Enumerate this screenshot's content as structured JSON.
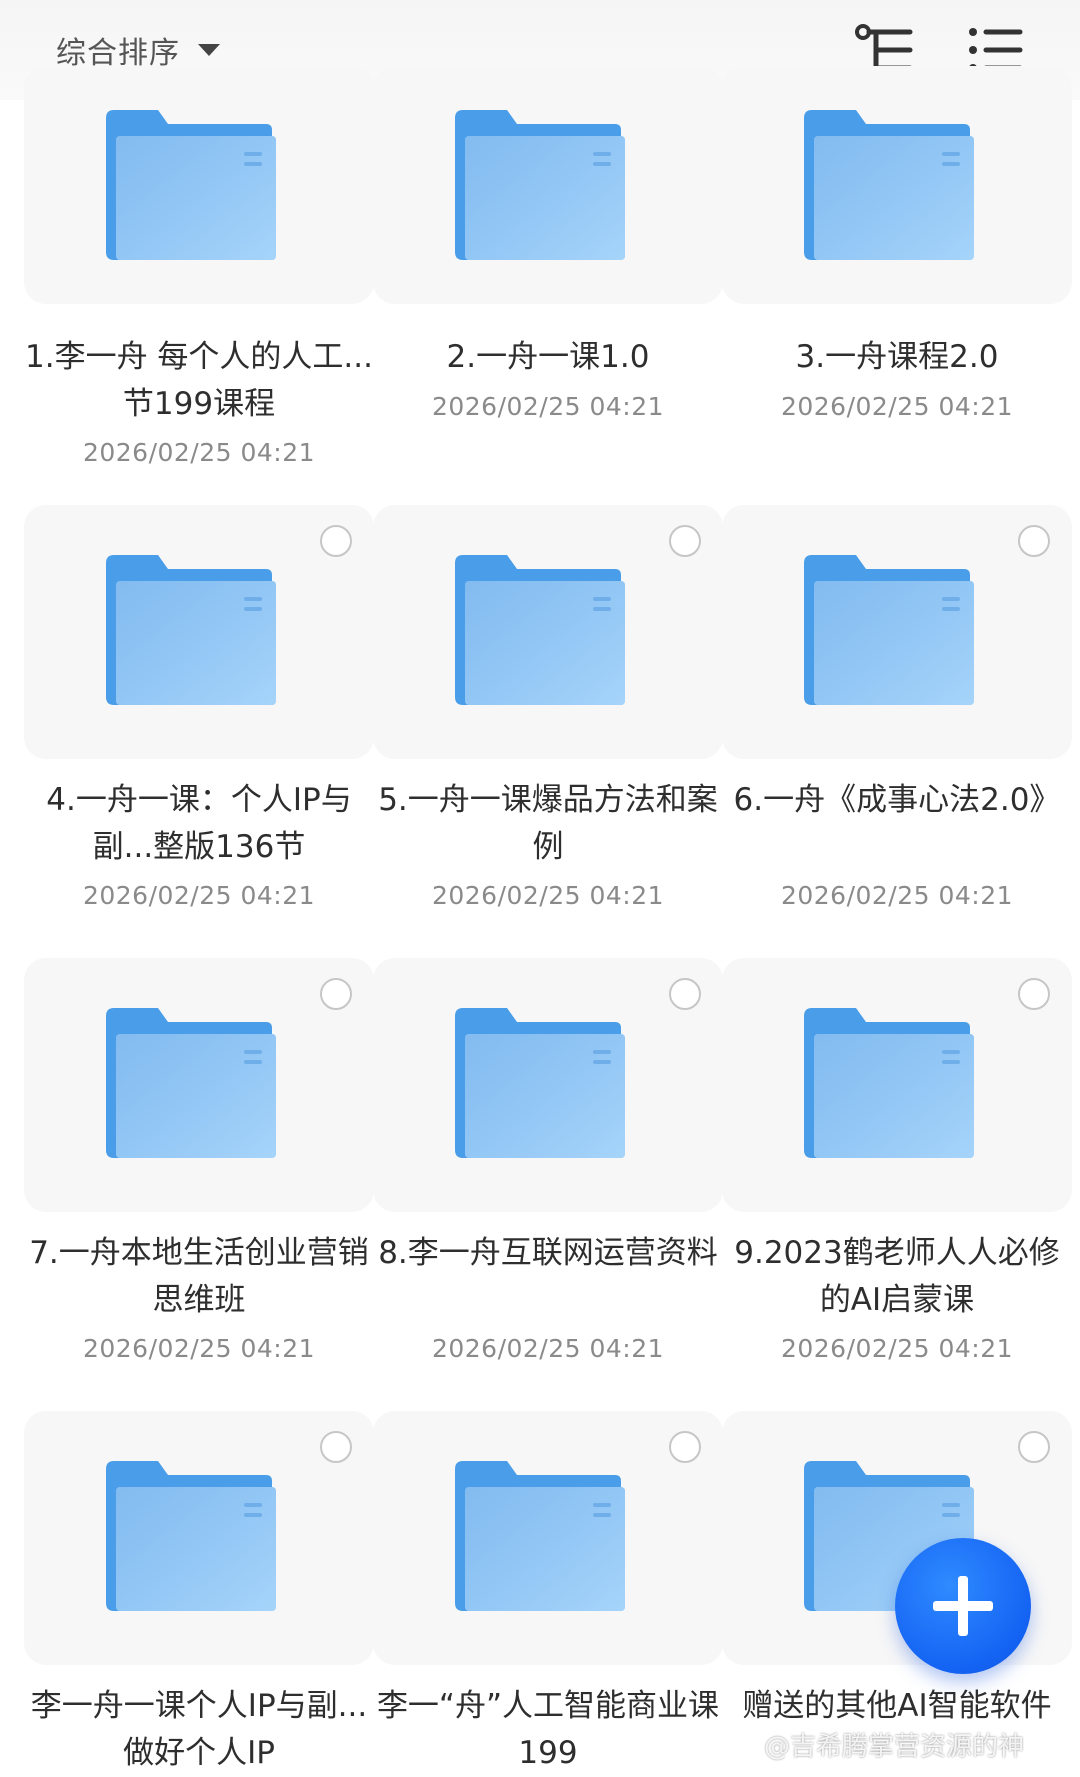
{
  "header": {
    "sort_label": "综合排序",
    "icons": [
      "hierarchy-icon",
      "list-view-icon"
    ]
  },
  "folders": [
    {
      "name": "1.李一舟 每个人的人工...节199课程",
      "date": "2026/02/25 04:21",
      "selectable": false
    },
    {
      "name": "2.一舟一课1.0",
      "date": "2026/02/25 04:21",
      "selectable": false
    },
    {
      "name": "3.一舟课程2.0",
      "date": "2026/02/25 04:21",
      "selectable": false
    },
    {
      "name": "4.一舟一课：个人IP与副...整版136节",
      "date": "2026/02/25 04:21",
      "selectable": true
    },
    {
      "name": "5.一舟一课爆品方法和案例",
      "date": "2026/02/25 04:21",
      "selectable": true
    },
    {
      "name": "6.一舟《成事心法2.0》",
      "date": "2026/02/25 04:21",
      "selectable": true
    },
    {
      "name": "7.一舟本地生活创业营销思维班",
      "date": "2026/02/25 04:21",
      "selectable": true
    },
    {
      "name": "8.李一舟互联网运营资料",
      "date": "2026/02/25 04:21",
      "selectable": true
    },
    {
      "name": "9.2023鹤老师人人必修的AI启蒙课",
      "date": "2026/02/25 04:21",
      "selectable": true
    },
    {
      "name": "李一舟一课个人IP与副...做好个人IP",
      "date": "",
      "selectable": true
    },
    {
      "name": "李一“舟”人工智能商业课199",
      "date": "",
      "selectable": true
    },
    {
      "name": "赠送的其他AI智能软件",
      "date": "",
      "selectable": true
    }
  ],
  "fab": {
    "icon": "plus-icon"
  },
  "watermark": {
    "text": "@吉希腾掌营资源的神"
  },
  "colors": {
    "folder_back": "#4a9de8",
    "folder_front": "#8cc4f3",
    "fab": "#1a6ef5",
    "date_text": "#8a8a8a"
  }
}
